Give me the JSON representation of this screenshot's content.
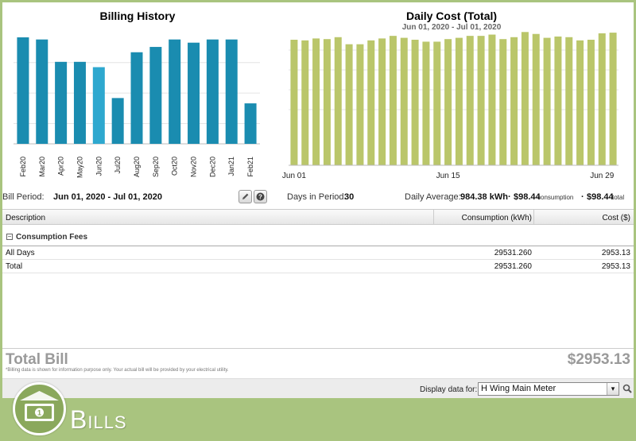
{
  "billing_chart": {
    "title": "Billing History",
    "chart_data": {
      "type": "bar",
      "categories": [
        "Feb20",
        "Mar20",
        "Apr20",
        "May20",
        "Jun20",
        "Jul20",
        "Aug20",
        "Sep20",
        "Oct20",
        "Nov20",
        "Dec20",
        "Jan21",
        "Feb21"
      ],
      "values": [
        100,
        98,
        77,
        77,
        72,
        43,
        86,
        91,
        98,
        95,
        98,
        98,
        38
      ],
      "highlight_index": 4,
      "ylim": [
        0,
        100
      ],
      "bar_color": "#1a8cb0",
      "highlight_color": "#2ea8cf"
    }
  },
  "daily_chart": {
    "title": "Daily Cost (Total)",
    "subtitle": "Jun 01, 2020 - Jul 01, 2020",
    "chart_data": {
      "type": "bar",
      "x_tick_labels": [
        {
          "label": "Jun 01",
          "index": 0
        },
        {
          "label": "Jun 15",
          "index": 14
        },
        {
          "label": "Jun 29",
          "index": 28
        }
      ],
      "values": [
        97.5,
        97,
        98.5,
        98,
        99.5,
        94,
        94,
        97,
        98.5,
        100.5,
        99,
        97.5,
        96,
        96,
        98,
        99,
        100.5,
        100.5,
        101.5,
        98,
        99.5,
        103.5,
        102,
        99,
        100,
        99.5,
        97,
        97.5,
        102.5,
        103
      ],
      "ylim": [
        0,
        108
      ],
      "bar_color": "#bac66a"
    }
  },
  "period": {
    "label": "Bill Period:",
    "value": "Jun 01, 2020 - Jul 01, 2020",
    "days_label": "Days in Period:",
    "days_value": "30",
    "avg_label": "Daily Average:",
    "avg_kwh": "984.38 kWh",
    "avg_sep1": "·",
    "avg_cons_cost": "$98.44",
    "avg_cons_label": "consumption",
    "avg_sep2": "·",
    "avg_total_cost": "$98.44",
    "avg_total_label": "total"
  },
  "icons": {
    "edit": "pencil-icon",
    "help": "help-icon"
  },
  "table": {
    "headers": {
      "description": "Description",
      "consumption": "Consumption (kWh)",
      "cost": "Cost ($)"
    },
    "group": {
      "label": "Consumption Fees",
      "toggle": "−"
    },
    "rows": [
      {
        "description": "All Days",
        "consumption": "29531.260",
        "cost": "2953.13"
      },
      {
        "description": "Total",
        "consumption": "29531.260",
        "cost": "2953.13"
      }
    ]
  },
  "total": {
    "label": "Total Bill",
    "value": "$2953.13",
    "disclaimer": "*Billing data is shown for information purpose only. Your actual bill will be provided by your electrical utility."
  },
  "display": {
    "label": "Display data for:",
    "selected": "H Wing Main Meter",
    "arrow": "▾"
  },
  "footer": {
    "title": "Bills"
  }
}
